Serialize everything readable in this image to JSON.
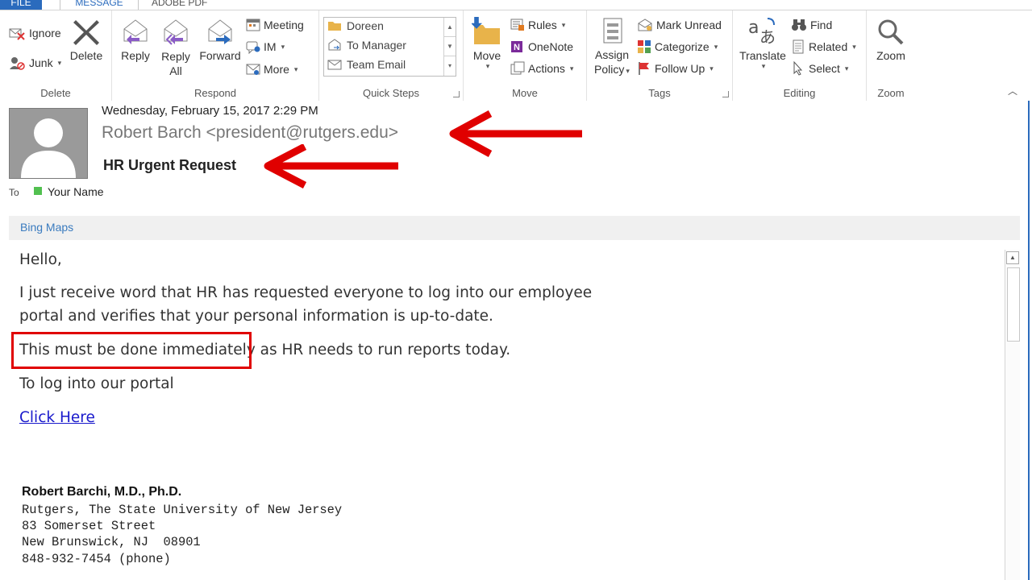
{
  "window": {
    "tabs": [
      "FILE",
      "MESSAGE",
      "ADOBE PDF"
    ]
  },
  "ribbon": {
    "delete_group": {
      "label": "Delete",
      "ignore": "Ignore",
      "junk": "Junk",
      "delete": "Delete"
    },
    "respond_group": {
      "label": "Respond",
      "reply": "Reply",
      "reply_all_1": "Reply",
      "reply_all_2": "All",
      "forward": "Forward",
      "meeting": "Meeting",
      "im": "IM",
      "more": "More"
    },
    "quick_steps_group": {
      "label": "Quick Steps",
      "items": [
        "Doreen",
        "To Manager",
        "Team Email"
      ]
    },
    "move_group": {
      "label": "Move",
      "move": "Move",
      "rules": "Rules",
      "onenote": "OneNote",
      "actions": "Actions"
    },
    "tags_group": {
      "label": "Tags",
      "assign_policy_1": "Assign",
      "assign_policy_2": "Policy",
      "mark_unread": "Mark Unread",
      "categorize": "Categorize",
      "follow_up": "Follow Up"
    },
    "editing_group": {
      "label": "Editing",
      "translate": "Translate",
      "find": "Find",
      "related": "Related",
      "select": "Select"
    },
    "zoom_group": {
      "label": "Zoom",
      "zoom": "Zoom"
    }
  },
  "message": {
    "date": "Wednesday, February 15, 2017 2:29 PM",
    "sender": "Robert Barch   <president@rutgers.edu>",
    "subject": "HR Urgent Request",
    "to_label": "To",
    "to_name": "Your Name",
    "addin": "Bing Maps",
    "body": {
      "greeting": "Hello,",
      "line1": "I just receive word that HR has requested everyone to log into our employee",
      "line2": "portal and verifies that your personal information is up-to-date.",
      "line3": "This must be done immediately as HR needs to run reports today.",
      "line4": "To log into our portal",
      "link": "Click Here"
    },
    "signature": {
      "name": "Robert Barchi, M.D., Ph.D.",
      "lines": [
        "Rutgers, The State University of New Jersey",
        "83 Somerset Street",
        "New Brunswick, NJ  08901",
        "848-932-7454 (phone)"
      ]
    }
  },
  "colors": {
    "accent": "#2b6bbd",
    "annotation": "#e00000",
    "link": "#1a1acc"
  }
}
